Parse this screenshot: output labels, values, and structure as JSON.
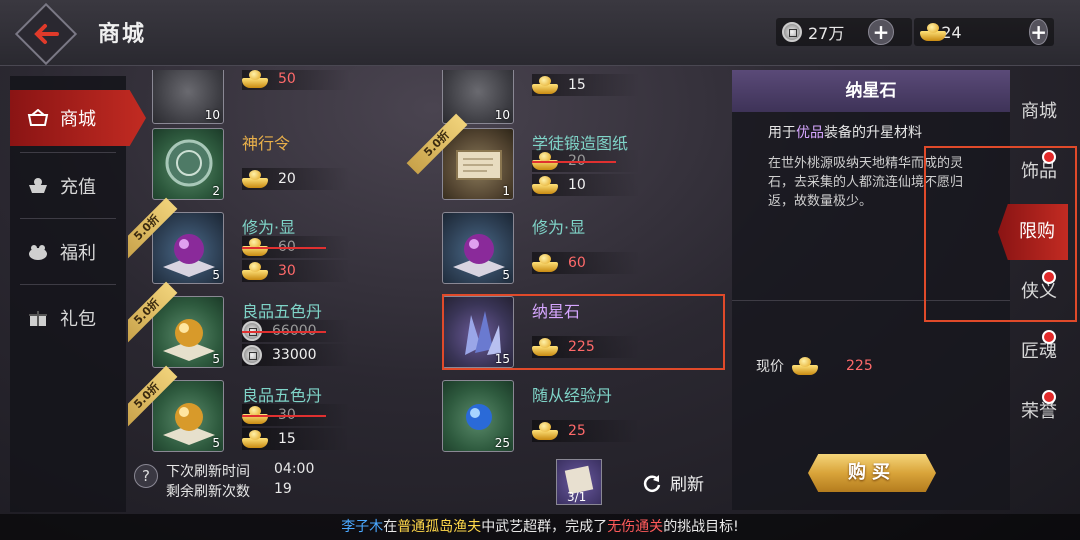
{
  "header": {
    "title": "商城",
    "silver_amount": "27万",
    "gold_amount": "24"
  },
  "sidebar": {
    "items": [
      {
        "label": "商城",
        "icon": "shop-icon"
      },
      {
        "label": "充值",
        "icon": "recharge-icon"
      },
      {
        "label": "福利",
        "icon": "welfare-icon"
      },
      {
        "label": "礼包",
        "icon": "gift-icon"
      }
    ]
  },
  "grid": {
    "items": [
      {
        "name": "",
        "qty": "10",
        "price": "50",
        "price_color": "red"
      },
      {
        "name": "",
        "qty": "10",
        "price": "15",
        "price_color": "white"
      },
      {
        "name": "神行令",
        "qty": "2",
        "price": "20",
        "price_color": "white"
      },
      {
        "name": "学徒锻造图纸",
        "qty": "1",
        "discount": "5.0折",
        "old_price": "20",
        "price": "10",
        "price_color": "white"
      },
      {
        "name": "修为·显",
        "qty": "5",
        "discount": "5.0折",
        "old_price": "60",
        "price": "30",
        "price_color": "red"
      },
      {
        "name": "修为·显",
        "qty": "5",
        "price": "60",
        "price_color": "red"
      },
      {
        "name": "良品五色丹",
        "qty": "5",
        "discount": "5.0折",
        "old_price": "66000",
        "price": "33000",
        "price_color": "white"
      },
      {
        "name": "纳星石",
        "qty": "15",
        "price": "225",
        "price_color": "red"
      },
      {
        "name": "良品五色丹",
        "qty": "5",
        "discount": "5.0折",
        "old_price": "30",
        "price": "15",
        "price_color": "white"
      },
      {
        "name": "随从经验丹",
        "qty": "25",
        "price": "25",
        "price_color": "red"
      }
    ]
  },
  "refresh": {
    "next_label": "下次刷新时间",
    "next_value": "04:00",
    "remain_label": "剩余刷新次数",
    "remain_value": "19",
    "ticket_count": "3/1",
    "button_label": "刷新"
  },
  "detail": {
    "name": "纳星石",
    "use_prefix": "用于",
    "use_highlight": "优品",
    "use_suffix": "装备的升星材料",
    "description": "在世外桃源吸纳天地精华而成的灵石，去采集的人都流连仙境不愿归返，故数量极少。",
    "price_label": "现价",
    "price_value": "225",
    "buy_label": "购买"
  },
  "right_tabs": [
    {
      "label": "商城",
      "badge": false
    },
    {
      "label": "饰品",
      "badge": true
    },
    {
      "label": "限购",
      "badge": false,
      "active": true
    },
    {
      "label": "侠义",
      "badge": true
    },
    {
      "label": "匠魂",
      "badge": true
    },
    {
      "label": "荣誉",
      "badge": true
    }
  ],
  "broadcast": {
    "player": "李子木",
    "t1": "在",
    "place": "普通孤岛渔夫",
    "t2": "中武艺超群，完成了",
    "goal": "无伤通关",
    "t3": "的挑战目标!"
  }
}
